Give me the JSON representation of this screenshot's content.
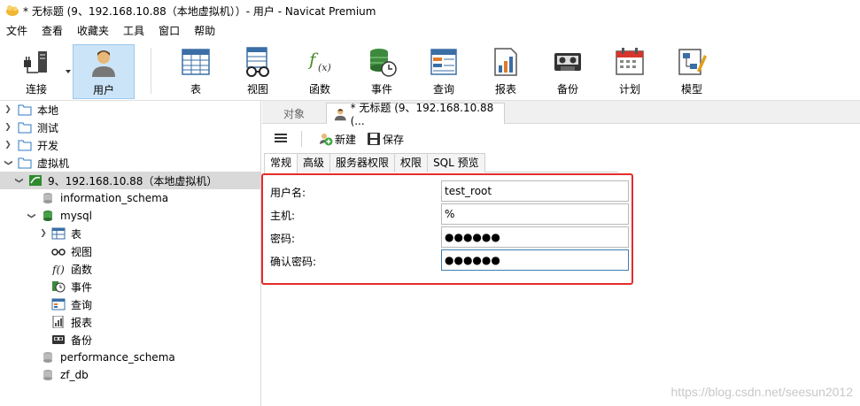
{
  "window": {
    "title": "* 无标题 (9、192.168.10.88（本地虚拟机））- 用户 - Navicat Premium"
  },
  "menu": [
    "文件",
    "查看",
    "收藏夹",
    "工具",
    "窗口",
    "帮助"
  ],
  "toolbar": {
    "connect": "连接",
    "user": "用户",
    "table": "表",
    "view": "视图",
    "function": "函数",
    "event": "事件",
    "query": "查询",
    "report": "报表",
    "backup": "备份",
    "schedule": "计划",
    "model": "模型"
  },
  "tree": {
    "local": "本地",
    "test": "测试",
    "dev": "开发",
    "vm": "虚拟机",
    "conn": "9、192.168.10.88（本地虚拟机）",
    "information_schema": "information_schema",
    "mysql": "mysql",
    "tables": "表",
    "views": "视图",
    "functions": "函数",
    "events": "事件",
    "queries": "查询",
    "reports": "报表",
    "backups": "备份",
    "performance_schema": "performance_schema",
    "zf_db": "zf_db"
  },
  "tabs": {
    "objects": "对象",
    "current": "* 无标题 (9、192.168.10.88 (..."
  },
  "actions": {
    "new": "新建",
    "save": "保存"
  },
  "subtabs": [
    "常规",
    "高级",
    "服务器权限",
    "权限",
    "SQL 预览"
  ],
  "form": {
    "username_label": "用户名:",
    "username_value": "test_root",
    "host_label": "主机:",
    "host_value": "%",
    "password_label": "密码:",
    "password_value": "●●●●●●",
    "confirm_label": "确认密码:",
    "confirm_value": "●●●●●●"
  },
  "watermark": "https://blog.csdn.net/seesun2012",
  "colors": {
    "highlight_border": "#e52c2c",
    "active_tool": "#cce4f7",
    "selected_row": "#d9d9d9"
  }
}
